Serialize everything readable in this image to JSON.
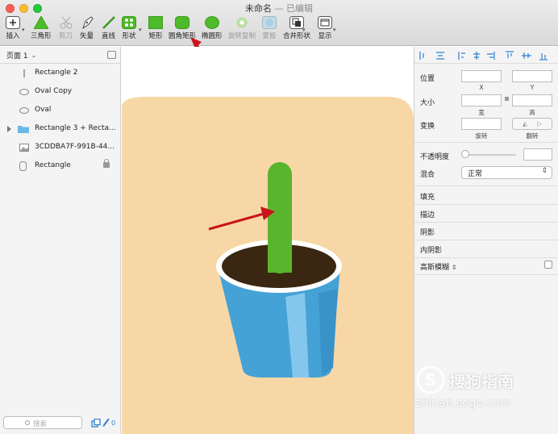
{
  "window": {
    "title": "未命名",
    "separator": " — ",
    "status": "已编辑"
  },
  "toolbar": [
    {
      "id": "insert",
      "label": "插入",
      "icon": "plus-icon"
    },
    {
      "id": "triangle",
      "label": "三角形",
      "icon": "triangle-icon"
    },
    {
      "id": "scissors",
      "label": "剪刀",
      "icon": "scissors-icon",
      "disabled": true
    },
    {
      "id": "vector",
      "label": "矢量",
      "icon": "pen-icon"
    },
    {
      "id": "line",
      "label": "直线",
      "icon": "line-icon"
    },
    {
      "id": "shape",
      "label": "形状",
      "icon": "shapes-icon"
    },
    {
      "id": "rect",
      "label": "矩形",
      "icon": "rectangle-icon"
    },
    {
      "id": "rounded",
      "label": "圆角矩形",
      "icon": "rounded-rectangle-icon"
    },
    {
      "id": "oval",
      "label": "椭圆形",
      "icon": "oval-icon"
    },
    {
      "id": "rotatecopy",
      "label": "旋转复制",
      "icon": "gear-icon",
      "disabled": true
    },
    {
      "id": "mask",
      "label": "蒙板",
      "icon": "mask-icon",
      "disabled": true
    },
    {
      "id": "combine",
      "label": "合并形状",
      "icon": "combine-icon"
    },
    {
      "id": "view",
      "label": "显示",
      "icon": "view-icon"
    }
  ],
  "sidebar": {
    "page": "页面 1",
    "layers": [
      {
        "name": "Rectangle 2",
        "icon": "rectangle-layer-icon"
      },
      {
        "name": "Oval Copy",
        "icon": "oval-layer-icon"
      },
      {
        "name": "Oval",
        "icon": "oval-layer-icon"
      },
      {
        "name": "Rectangle 3 + Recta...",
        "icon": "folder-icon"
      },
      {
        "name": "3CDDBA7F-991B-44...",
        "icon": "image-layer-icon"
      },
      {
        "name": "Rectangle",
        "icon": "rounded-rectangle-layer-icon",
        "locked": true
      }
    ],
    "search_placeholder": "搜索",
    "badge_count": "0"
  },
  "inspector": {
    "position": "位置",
    "x": "X",
    "y": "Y",
    "size": "大小",
    "width": "宽",
    "height": "高",
    "transform": "变换",
    "rotate": "旋转",
    "flip": "翻转",
    "opacity": "不透明度",
    "blend": "混合",
    "blend_value": "正常",
    "fill": "填充",
    "border": "描边",
    "shadow": "阴影",
    "inner_shadow": "内阴影",
    "blur": "高斯模糊"
  },
  "watermark": {
    "brand": "搜狗指南",
    "url": "zhinan.sogo.com"
  },
  "colors": {
    "accent": "#5ab52e",
    "sand": "#f8d7a6",
    "pot": "#45a2d6",
    "soil": "#3a2711",
    "arrow": "#c8151b"
  }
}
